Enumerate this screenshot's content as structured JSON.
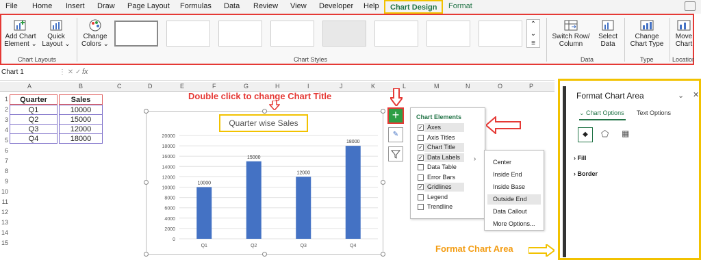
{
  "menu": {
    "tabs": [
      "File",
      "Home",
      "Insert",
      "Draw",
      "Page Layout",
      "Formulas",
      "Data",
      "Review",
      "View",
      "Developer",
      "Help",
      "Chart Design",
      "Format"
    ]
  },
  "ribbon": {
    "add_chart_element": "Add Chart Element ⌄",
    "quick_layout": "Quick Layout ⌄",
    "chart_layouts_group": "Chart Layouts",
    "change_colors": "Change Colors ⌄",
    "chart_styles_group": "Chart Styles",
    "switch_row_column": "Switch Row/ Column",
    "select_data": "Select Data",
    "data_group": "Data",
    "change_chart_type": "Change Chart Type",
    "type_group": "Type",
    "move_chart": "Move Chart",
    "location_group": "Location"
  },
  "formula_bar": {
    "name_box": "Chart 1",
    "fx": "fx"
  },
  "columns": [
    "A",
    "B",
    "C",
    "D",
    "E",
    "F",
    "G",
    "H",
    "I",
    "J",
    "K",
    "L",
    "M",
    "N",
    "O",
    "P"
  ],
  "rows": [
    "1",
    "2",
    "3",
    "4",
    "5",
    "6",
    "7",
    "8",
    "9",
    "10",
    "11",
    "12",
    "13",
    "14",
    "15"
  ],
  "table": {
    "headers": [
      "Quarter",
      "Sales"
    ],
    "rows": [
      [
        "Q1",
        "10000"
      ],
      [
        "Q2",
        "15000"
      ],
      [
        "Q3",
        "12000"
      ],
      [
        "Q4",
        "18000"
      ]
    ]
  },
  "annotations": {
    "change_title": "Double click to change Chart Title",
    "format_area": "Format Chart Area"
  },
  "chart_data": {
    "type": "bar",
    "title": "Quarter wise Sales",
    "categories": [
      "Q1",
      "Q2",
      "Q3",
      "Q4"
    ],
    "values": [
      10000,
      15000,
      12000,
      18000
    ],
    "data_labels": [
      "10000",
      "15000",
      "12000",
      "18000"
    ],
    "ylim": [
      0,
      20000
    ],
    "yticks": [
      "0",
      "2000",
      "4000",
      "6000",
      "8000",
      "10000",
      "12000",
      "14000",
      "16000",
      "18000",
      "20000"
    ],
    "bar_color": "#4472c4",
    "grid": true
  },
  "chart_elements": {
    "title": "Chart Elements",
    "items": [
      {
        "label": "Axes",
        "checked": true
      },
      {
        "label": "Axis Titles",
        "checked": false
      },
      {
        "label": "Chart Title",
        "checked": true
      },
      {
        "label": "Data Labels",
        "checked": true
      },
      {
        "label": "Data Table",
        "checked": false
      },
      {
        "label": "Error Bars",
        "checked": false
      },
      {
        "label": "Gridlines",
        "checked": true
      },
      {
        "label": "Legend",
        "checked": false
      },
      {
        "label": "Trendline",
        "checked": false
      }
    ]
  },
  "data_labels_menu": [
    "Center",
    "Inside End",
    "Inside Base",
    "Outside End",
    "Data Callout",
    "More Options..."
  ],
  "format_pane": {
    "title": "Format Chart Area",
    "tab_chart": "Chart Options",
    "tab_text": "Text Options",
    "fill": "Fill",
    "border": "Border"
  },
  "colors": {
    "accent": "#e53935",
    "highlight": "#f2c200",
    "excel_green": "#217346"
  }
}
